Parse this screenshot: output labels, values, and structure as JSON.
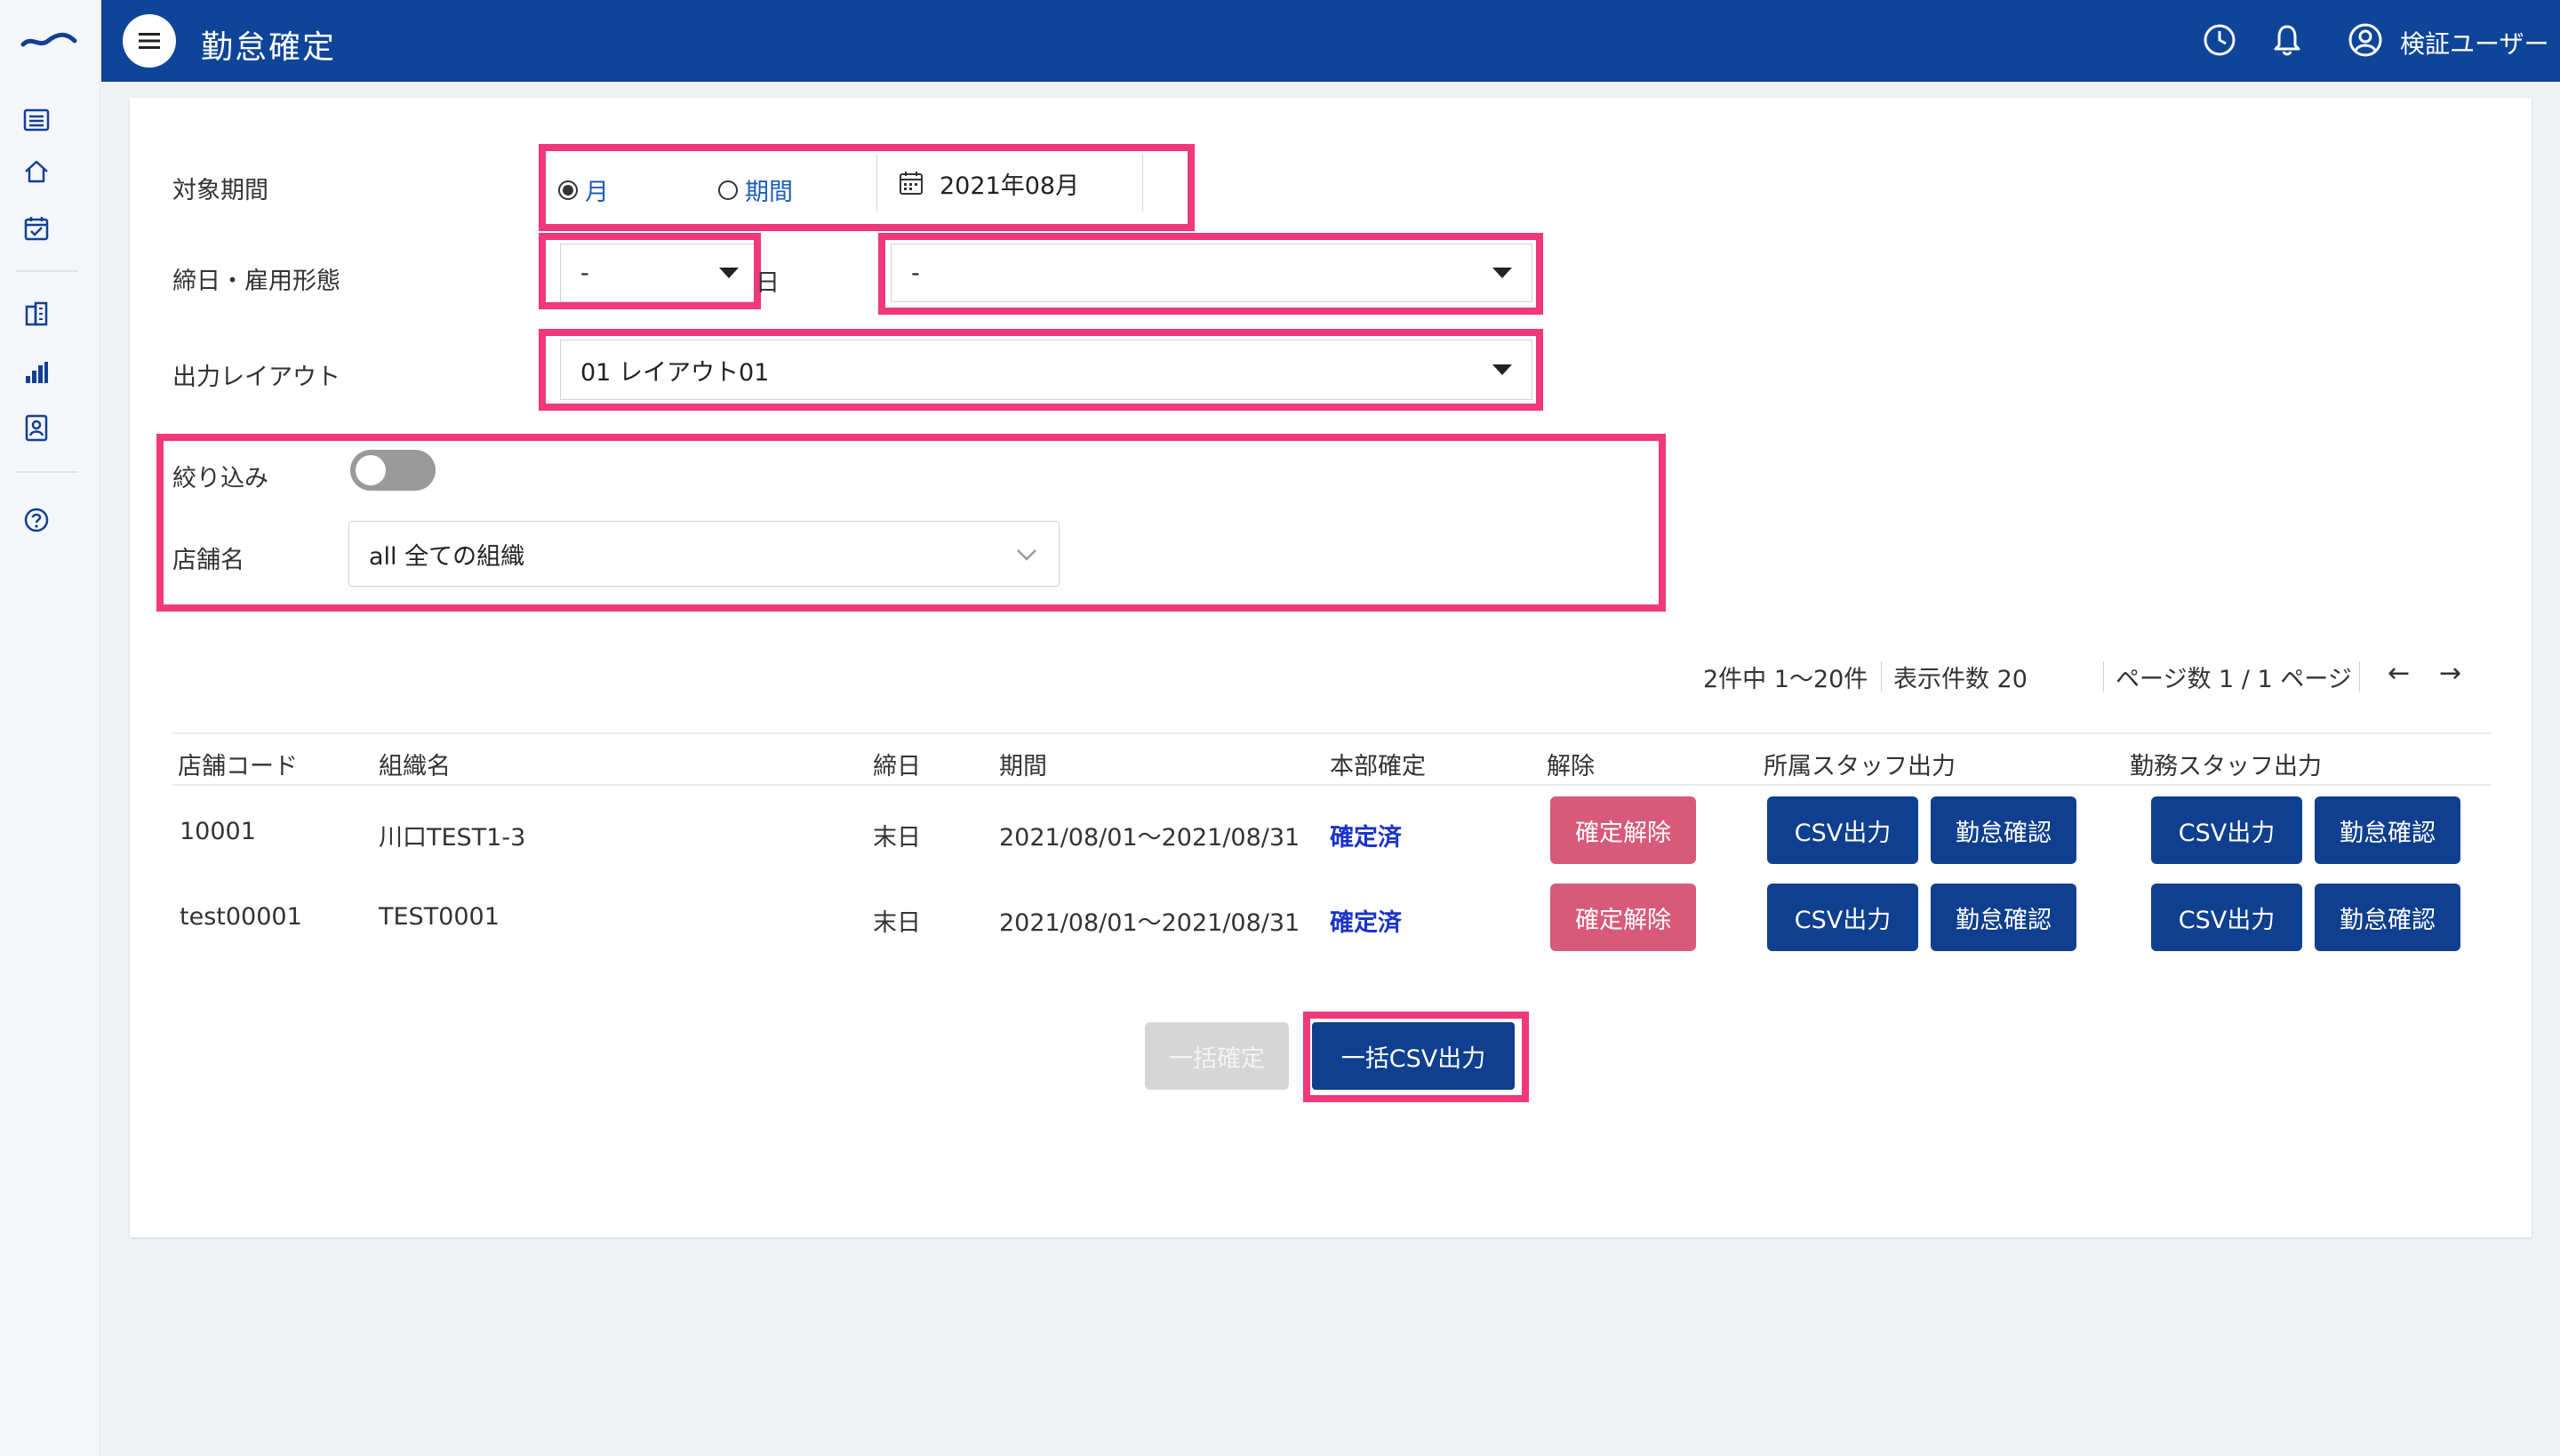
{
  "app": {
    "logo": "wave-logo",
    "page_title": "勤怠確定",
    "user_name": "検証ユーザー"
  },
  "sidebar": {
    "items": [
      {
        "icon": "list-icon"
      },
      {
        "icon": "home-icon"
      },
      {
        "icon": "calendar-check-icon"
      },
      {
        "icon": "building-icon"
      },
      {
        "icon": "bar-chart-icon"
      },
      {
        "icon": "id-card-icon"
      },
      {
        "icon": "help-icon"
      }
    ]
  },
  "form": {
    "period_label": "対象期間",
    "radio_month": "月",
    "radio_period": "期間",
    "month_value": "2021年08月",
    "closing_label": "締日・雇用形態",
    "closing_value": "-",
    "day_suffix": "日",
    "employment_value": "-",
    "layout_label": "出力レイアウト",
    "layout_value": "01 レイアウト01",
    "filter_label": "絞り込み",
    "filter_enabled": false,
    "store_label": "店舗名",
    "store_value": "all 全ての組織"
  },
  "pager": {
    "range": "2件中 1〜20件",
    "per_page": "表示件数 20",
    "pages": "ページ数 1 / 1 ページ",
    "prev": "←",
    "next": "→"
  },
  "table": {
    "headers": [
      "店舗コード",
      "組織名",
      "締日",
      "期間",
      "本部確定",
      "解除",
      "所属スタッフ出力",
      "勤務スタッフ出力"
    ],
    "rows": [
      {
        "code": "10001",
        "org": "川口TEST1-3",
        "closing": "末日",
        "period": "2021/08/01〜2021/08/31",
        "status": "確定済",
        "unlock": "確定解除",
        "csv1": "CSV出力",
        "check1": "勤怠確認",
        "csv2": "CSV出力",
        "check2": "勤怠確認"
      },
      {
        "code": "test00001",
        "org": "TEST0001",
        "closing": "末日",
        "period": "2021/08/01〜2021/08/31",
        "status": "確定済",
        "unlock": "確定解除",
        "csv1": "CSV出力",
        "check1": "勤怠確認",
        "csv2": "CSV出力",
        "check2": "勤怠確認"
      }
    ]
  },
  "footer": {
    "bulk_confirm": "一括確定",
    "bulk_csv": "一括CSV出力"
  },
  "colors": {
    "header": "#0f4598",
    "highlight": "#f0387a",
    "primary_button": "#0f3f8e",
    "unlock_button": "#d85a7a",
    "status_text": "#1a34c9"
  }
}
